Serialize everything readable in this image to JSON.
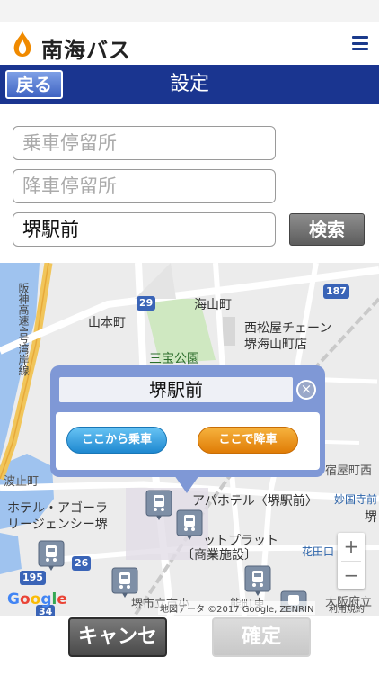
{
  "brand": {
    "name": "南海バス",
    "logo_icon": "nankai-flame-logo",
    "menu_icon": "hamburger-menu-icon"
  },
  "header": {
    "back_label": "戻る",
    "title": "設定"
  },
  "form": {
    "board_stop_placeholder": "乗車停留所",
    "alight_stop_placeholder": "降車停留所",
    "search_value": "堺駅前",
    "search_button_label": "検索"
  },
  "map": {
    "labels": {
      "yamamoto": "山本町",
      "kaizan": "海山町",
      "sanpo_park": "三宝公園",
      "nishimatsuya_1": "西松屋チェーン",
      "nishimatsuya_2": "堺海山町店",
      "hanshin": "阪神高速4号湾岸線",
      "hotel_agora_1": "ホテル・アゴーラ",
      "hotel_agora_2": "リージェンシー堺",
      "apa_hotel": "アパホテル〈堺駅前〉",
      "myokokuji": "妙国寺前",
      "outlet_1": "ットプラット",
      "outlet_2": "〔商業施設〕",
      "hanadaguchi": "花田口",
      "shukuya": "宿屋町西",
      "sakai_city": "堺市立市小",
      "osaka_pref": "大阪府立",
      "kuzuchi": "波止町",
      "kushi": "能町東",
      "sakai_right": "堺"
    },
    "route_shields": {
      "r29": "29",
      "r187": "187",
      "r195": "195",
      "r26": "26",
      "r34": "34"
    },
    "zoom_in": "+",
    "zoom_out": "−",
    "google": "Google",
    "attribution": "地図データ ©2017 Google, ZENRIN",
    "terms": "利用規約"
  },
  "popup": {
    "stop_name": "堺駅前",
    "close_symbol": "×",
    "board_here_label": "ここから乗車",
    "alight_here_label": "ここで降車"
  },
  "footer": {
    "cancel_label": "キャンセル",
    "confirm_label": "確定"
  },
  "colors": {
    "header_blue": "#1a3590",
    "popup_blue": "#7f98d6",
    "board_btn": "#1e88d0",
    "alight_btn": "#e07c06"
  }
}
